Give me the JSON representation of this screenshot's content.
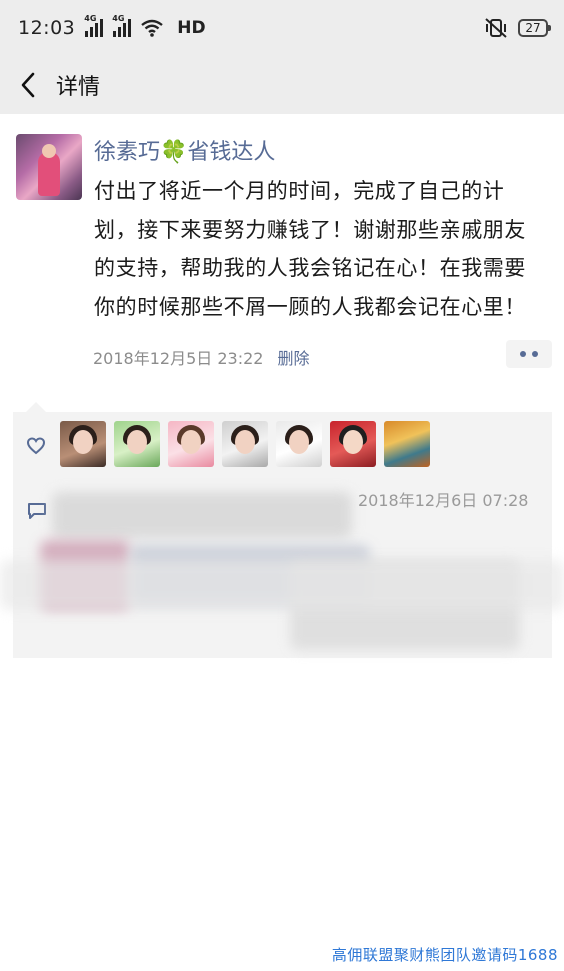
{
  "status_bar": {
    "time": "12:03",
    "network_1": "4G",
    "network_2": "4G",
    "hd": "HD",
    "battery": "27"
  },
  "nav": {
    "title": "详情",
    "back_icon": "chevron-left-icon"
  },
  "post": {
    "author_prefix": "徐素巧",
    "author_emoji": "🍀",
    "author_suffix": "省钱达人",
    "content": "付出了将近一个月的时间，完成了自己的计划，接下来要努力赚钱了！谢谢那些亲戚朋友的支持，帮助我的人我会铭记在心！在我需要你的时候那些不屑一顾的人我都会记在心里！",
    "timestamp": "2018年12月5日 23:22",
    "delete_label": "删除"
  },
  "interactions": {
    "like_icon": "heart-icon",
    "comment_icon": "comment-icon",
    "likers_count": 7,
    "comment_time": "2018年12月6日 07:28"
  },
  "watermark": "高佣联盟聚财熊团队邀请码1688",
  "colors": {
    "link": "#576b95",
    "bar_bg": "#ededed",
    "box_bg": "#f3f3f3",
    "watermark": "#2f78d6"
  }
}
